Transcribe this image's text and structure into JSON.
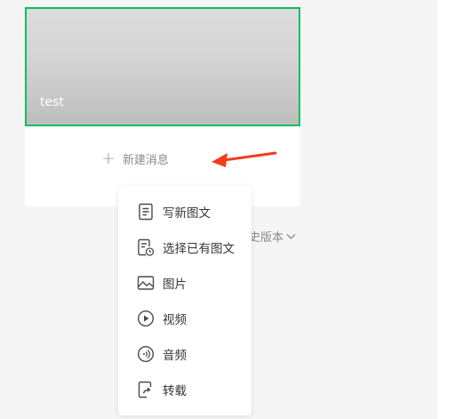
{
  "card": {
    "cover_title": "test",
    "new_message_label": "新建消息"
  },
  "history_label": "史版本",
  "menu": {
    "items": [
      {
        "label": "写新图文",
        "icon": "document-icon"
      },
      {
        "label": "选择已有图文",
        "icon": "document-clock-icon"
      },
      {
        "label": "图片",
        "icon": "image-icon"
      },
      {
        "label": "视频",
        "icon": "play-circle-icon"
      },
      {
        "label": "音频",
        "icon": "audio-wave-icon"
      },
      {
        "label": "转载",
        "icon": "share-icon"
      }
    ]
  },
  "colors": {
    "accent_border": "#07c160",
    "annotation_arrow": "#f13c1d",
    "text": "#353535",
    "muted_text": "#8a8a8a"
  }
}
